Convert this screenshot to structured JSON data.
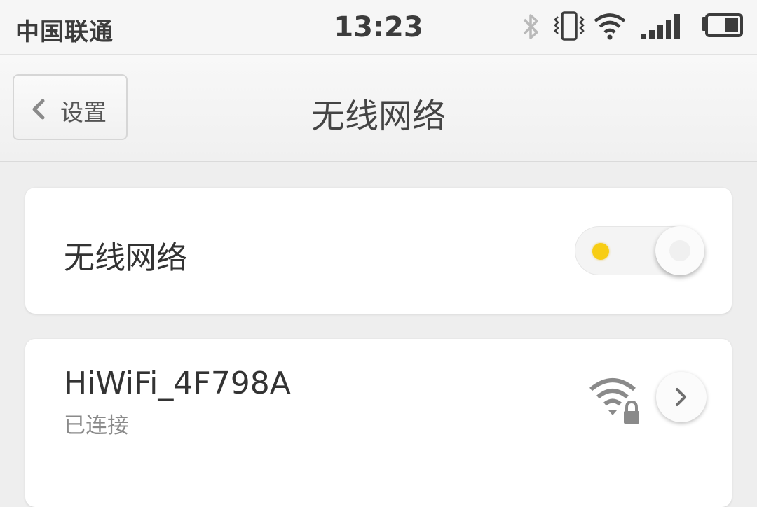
{
  "status_bar": {
    "carrier": "中国联通",
    "time": "13:23",
    "icons": [
      "bluetooth-icon",
      "vibrate-icon",
      "wifi-icon",
      "signal-icon",
      "battery-icon"
    ]
  },
  "nav": {
    "back_label": "设置",
    "title": "无线网络"
  },
  "wifi_toggle": {
    "label": "无线网络",
    "enabled": true,
    "indicator_color": "#f7cd14"
  },
  "networks": [
    {
      "name": "HiWiFi_4F798A",
      "status": "已连接",
      "secured": true
    }
  ]
}
